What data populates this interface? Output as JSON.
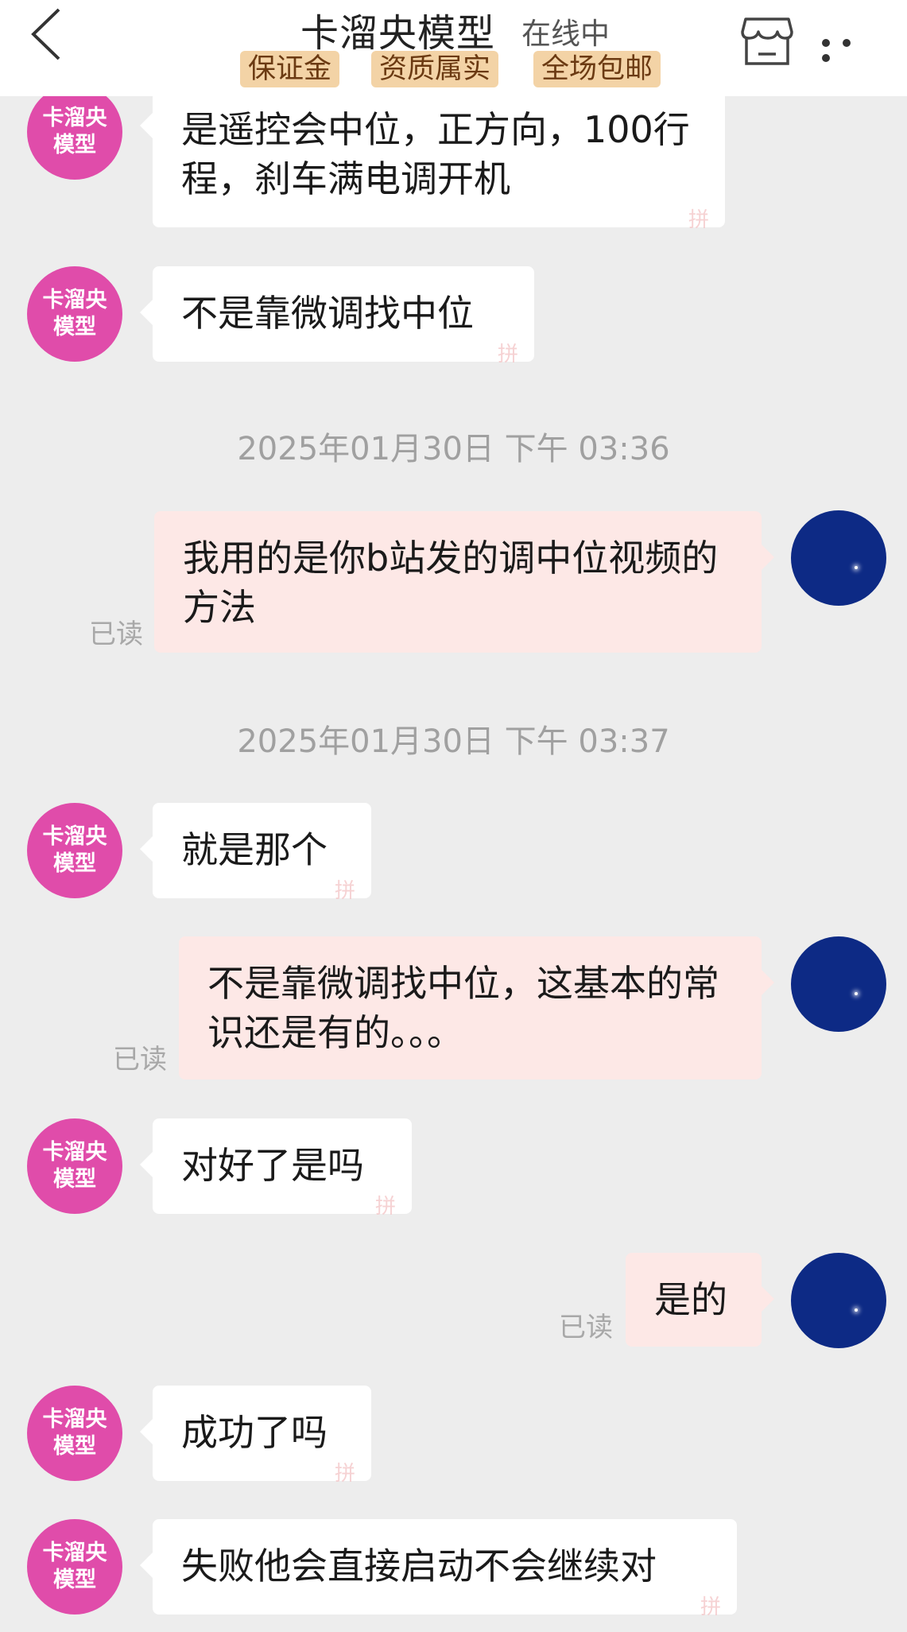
{
  "header": {
    "title": "卡溜央模型",
    "status": "在线中",
    "badges": [
      "保证金",
      "资质属实",
      "全场包邮"
    ]
  },
  "shop_avatar_text": [
    "卡溜央",
    "模型"
  ],
  "timestamps": [
    "2025年01月30日 下午 03:36",
    "2025年01月30日 下午 03:37"
  ],
  "read_label": "已读",
  "messages": [
    {
      "side": "in",
      "text": "是遥控会中位，正方向，100行程，刹车满电调开机"
    },
    {
      "side": "in",
      "text": "不是靠微调找中位"
    },
    {
      "side": "out",
      "text": "我用的是你b站发的调中位视频的方法"
    },
    {
      "side": "in",
      "text": "就是那个"
    },
    {
      "side": "out",
      "text": "不是靠微调找中位，这基本的常识还是有的。。。"
    },
    {
      "side": "in",
      "text": "对好了是吗"
    },
    {
      "side": "out",
      "text": "是的"
    },
    {
      "side": "in",
      "text": "成功了吗"
    },
    {
      "side": "in",
      "text": "失败他会直接启动不会继续对"
    }
  ],
  "colors": {
    "header_bg": "#ffffff",
    "page_bg": "#ededed",
    "incoming_bubble": "#ffffff",
    "outgoing_bubble": "#fde8e6",
    "shop_avatar": "#e04caa",
    "my_avatar": "#0d2a85",
    "badge_bg": "#f3d3a6"
  },
  "icons": [
    "back-icon",
    "shop-icon",
    "more-icon"
  ]
}
